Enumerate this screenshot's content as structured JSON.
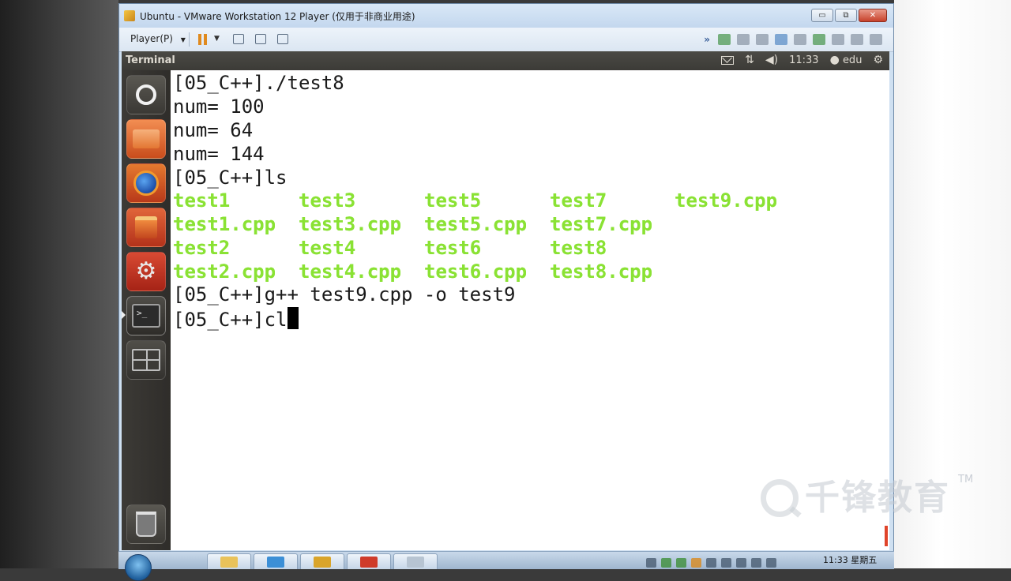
{
  "vmware": {
    "title": "Ubuntu - VMware Workstation 12 Player (仅用于非商业用途)",
    "player_menu": "Player(P)",
    "minimize_glyph": "▭",
    "restore_glyph": "⧉",
    "close_glyph": "✕",
    "dropdown_glyph": "▼",
    "more_glyph": "»"
  },
  "ubuntu": {
    "panel_title": "Terminal",
    "time": "11:33",
    "user": "edu",
    "launcher_items": [
      "dash-home",
      "files",
      "firefox",
      "software-center",
      "system-settings",
      "terminal",
      "workspace-switcher",
      "trash"
    ]
  },
  "terminal": {
    "prompt": "[05_C++]",
    "lines": [
      "[05_C++]./test8",
      "num= 100",
      "num= 64",
      "num= 144",
      "[05_C++]ls"
    ],
    "ls_rows": [
      [
        "test1",
        "test3",
        "test5",
        "test7",
        "test9.cpp"
      ],
      [
        "test1.cpp",
        "test3.cpp",
        "test5.cpp",
        "test7.cpp",
        ""
      ],
      [
        "test2",
        "test4",
        "test6",
        "test8",
        ""
      ],
      [
        "test2.cpp",
        "test4.cpp",
        "test6.cpp",
        "test8.cpp",
        ""
      ]
    ],
    "after_lines": [
      "[05_C++]g++ test9.cpp -o test9"
    ],
    "current_input": "[05_C++]cl",
    "ls_color": "#8ae234"
  },
  "watermark": {
    "text": "千锋教育",
    "tm": "TM"
  },
  "taskbar": {
    "clock": "11:33 星期五"
  },
  "icons": {
    "pause": "pause-icon",
    "mail": "envelope-icon",
    "network": "network-arrows-icon",
    "volume": "speaker-icon",
    "user": "person-icon",
    "gear": "gear-icon"
  }
}
